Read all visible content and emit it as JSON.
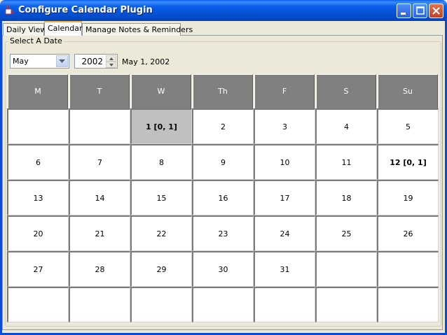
{
  "window": {
    "title": "Configure Calendar Plugin"
  },
  "tabs": [
    {
      "label": "Daily View",
      "selected": false
    },
    {
      "label": "Calendar",
      "selected": true
    },
    {
      "label": "Manage Notes & Reminders",
      "selected": false
    }
  ],
  "group_label": "Select A Date",
  "month": {
    "value": "May"
  },
  "year": {
    "value": "2002"
  },
  "date_label": "May 1, 2002",
  "calendar": {
    "day_headers": [
      "M",
      "T",
      "W",
      "Th",
      "F",
      "S",
      "Su"
    ],
    "weeks": [
      [
        "",
        "",
        "1 [0, 1]",
        "2",
        "3",
        "4",
        "5"
      ],
      [
        "6",
        "7",
        "8",
        "9",
        "10",
        "11",
        "12 [0, 1]"
      ],
      [
        "13",
        "14",
        "15",
        "16",
        "17",
        "18",
        "19"
      ],
      [
        "20",
        "21",
        "22",
        "23",
        "24",
        "25",
        "26"
      ],
      [
        "27",
        "28",
        "29",
        "30",
        "31",
        "",
        ""
      ],
      [
        "",
        "",
        "",
        "",
        "",
        "",
        ""
      ]
    ],
    "selected_day": "1",
    "bold_days": [
      "12"
    ]
  },
  "colors": {
    "header_bg": "#808080",
    "selected_bg": "#C0C0C0",
    "titlebar": "#0A5FEB"
  }
}
